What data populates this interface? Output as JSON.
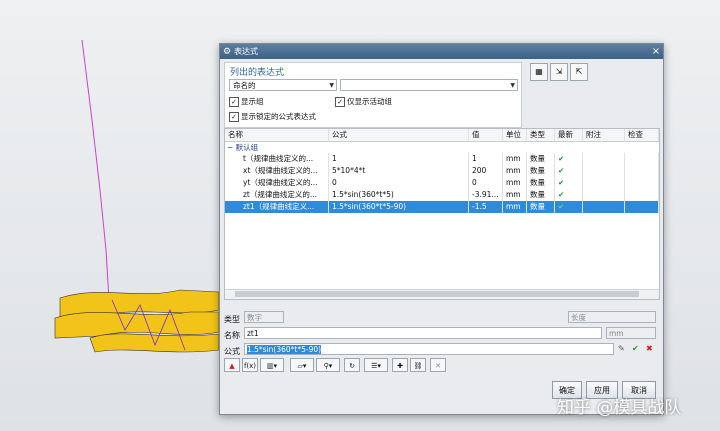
{
  "dialog": {
    "title": "表达式",
    "close": "×"
  },
  "list_group": {
    "header": "列出的表达式",
    "filter_select": "命名的",
    "filter_select2": "",
    "chk_show_groups": "显示组",
    "chk_active_only": "仅显示活动组",
    "chk_locked": "显示锁定的公式表达式"
  },
  "table": {
    "headers": [
      "名称",
      "公式",
      "值",
      "单位",
      "类型",
      "最新",
      "附注",
      "检查"
    ],
    "group_label": "默认组",
    "rows": [
      {
        "name": "t（规律曲线定义的...",
        "formula": "1",
        "value": "1",
        "unit": "mm",
        "type": "数量",
        "latest": "✔"
      },
      {
        "name": "xt（规律曲线定义的...",
        "formula": "5*10*4*t",
        "value": "200",
        "unit": "mm",
        "type": "数量",
        "latest": "✔"
      },
      {
        "name": "yt（规律曲线定义的...",
        "formula": "0",
        "value": "0",
        "unit": "mm",
        "type": "数量",
        "latest": "✔"
      },
      {
        "name": "zt（规律曲线定义的...",
        "formula": "1.5*sin(360*t*5)",
        "value": "-3.91...",
        "unit": "mm",
        "type": "数量",
        "latest": "✔"
      },
      {
        "name": "zt1（规律曲线定义...",
        "formula": "1.5*sin(360*t*5-90)",
        "value": "-1.5",
        "unit": "mm",
        "type": "数量",
        "latest": "✔"
      }
    ]
  },
  "fields": {
    "type_label": "类型",
    "type_value": "数字",
    "length_value": "长度",
    "name_label": "名称",
    "name_value": "zt1",
    "unit_value": "mm",
    "formula_label": "公式",
    "formula_value": "1.5*sin(360*t*5-90)"
  },
  "buttons": {
    "ok": "确定",
    "apply": "应用",
    "cancel": "取消"
  },
  "watermark": "知乎 @模具战队"
}
